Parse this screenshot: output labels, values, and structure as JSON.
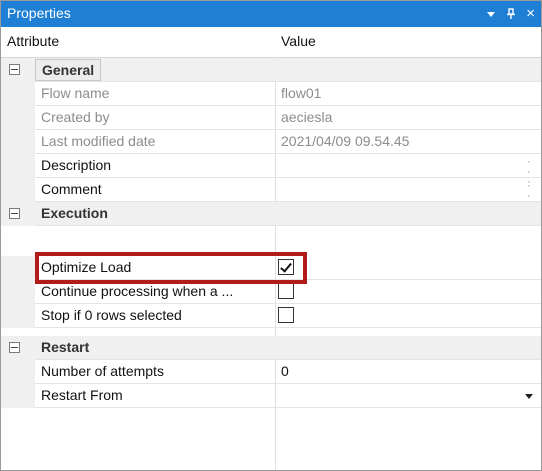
{
  "panel": {
    "title": "Properties",
    "controls": [
      "chevron-down-icon",
      "pin-icon",
      "close-icon"
    ],
    "close_glyph": "×"
  },
  "columns": {
    "attribute": "Attribute",
    "value": "Value"
  },
  "sections": {
    "general": {
      "label": "General",
      "rows": {
        "flow_name": {
          "label": "Flow name",
          "value": "flow01"
        },
        "created_by": {
          "label": "Created by",
          "value": "aeciesla"
        },
        "last_modified": {
          "label": "Last modified date",
          "value": "2021/04/09 09.54.45"
        },
        "description": {
          "label": "Description",
          "value": ""
        },
        "comment": {
          "label": "Comment",
          "value": ""
        }
      }
    },
    "execution": {
      "label": "Execution",
      "rows": {
        "optimize_load": {
          "label": "Optimize Load",
          "checked": true
        },
        "continue_processing": {
          "label": "Continue processing when a ...",
          "checked": false
        },
        "stop_if_zero": {
          "label": "Stop if 0 rows selected",
          "checked": false
        }
      }
    },
    "restart": {
      "label": "Restart",
      "rows": {
        "attempts": {
          "label": "Number of attempts",
          "value": "0"
        },
        "restart_from": {
          "label": "Restart From",
          "value": ""
        }
      }
    }
  },
  "colors": {
    "titlebar": "#1e7fd4",
    "highlight": "#b31b1b"
  }
}
